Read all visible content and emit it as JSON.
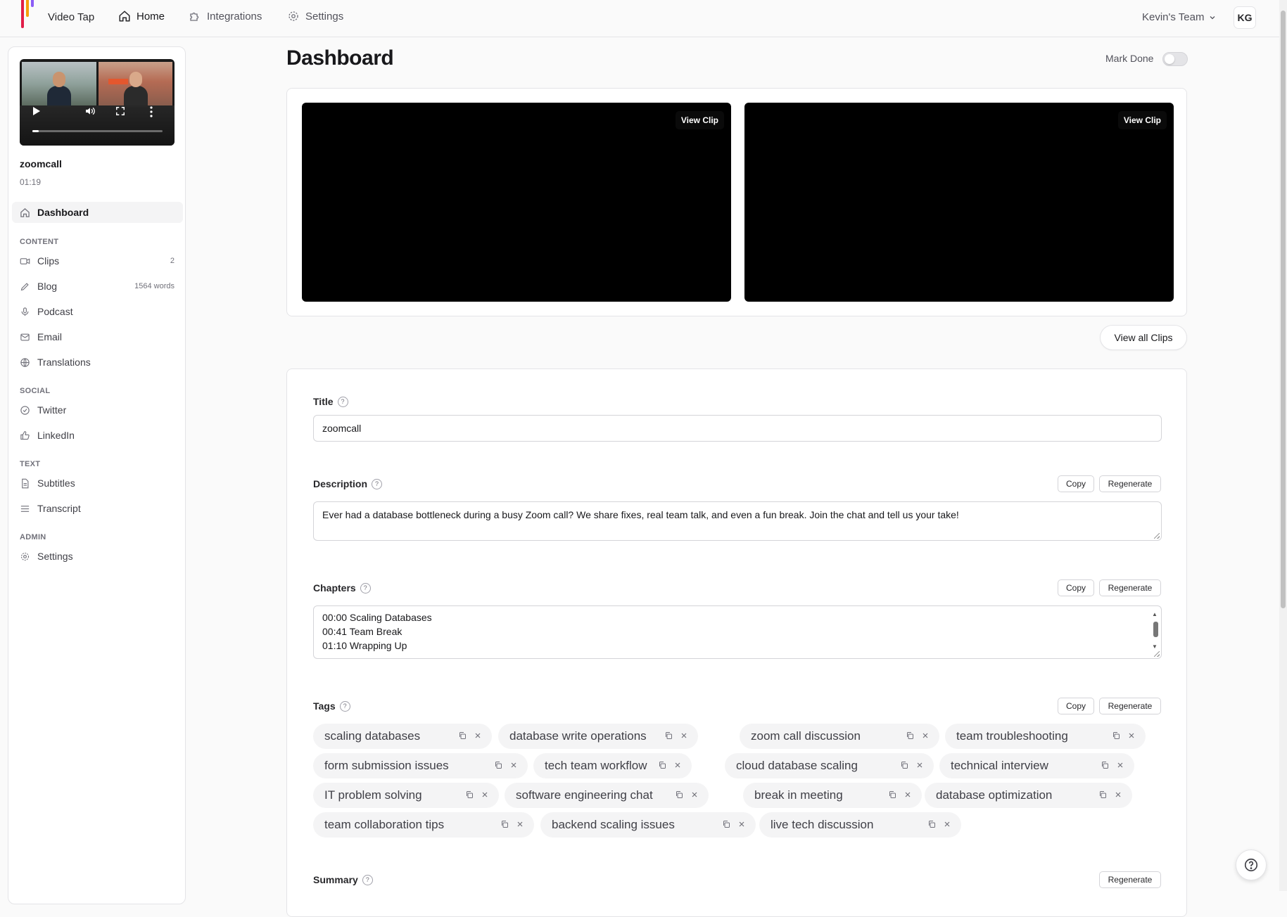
{
  "app": {
    "brand": "Video Tap",
    "nav": [
      {
        "label": "Home",
        "icon": "home-icon"
      },
      {
        "label": "Integrations",
        "icon": "puzzle-icon"
      },
      {
        "label": "Settings",
        "icon": "gear-icon"
      }
    ],
    "team": "Kevin's Team",
    "avatar_initials": "KG",
    "logo_colors": [
      "#e11d48",
      "#f59e0b",
      "#8b5cf6"
    ]
  },
  "sidebar": {
    "video": {
      "title": "zoomcall",
      "duration": "01:19",
      "progress": 0.05
    },
    "dashboard": "Dashboard",
    "sections": {
      "content": "CONTENT",
      "social": "SOCIAL",
      "text": "TEXT",
      "admin": "ADMIN"
    },
    "items": {
      "clips": {
        "label": "Clips",
        "count": "2"
      },
      "blog": {
        "label": "Blog",
        "count": "1564 words"
      },
      "podcast": {
        "label": "Podcast"
      },
      "email": {
        "label": "Email"
      },
      "translations": {
        "label": "Translations"
      },
      "twitter": {
        "label": "Twitter"
      },
      "linkedin": {
        "label": "LinkedIn"
      },
      "subtitles": {
        "label": "Subtitles"
      },
      "transcript": {
        "label": "Transcript"
      },
      "settings": {
        "label": "Settings"
      }
    }
  },
  "main": {
    "page_title": "Dashboard",
    "mark_done": {
      "label": "Mark Done",
      "checked": false
    },
    "clips": {
      "view_clip_label": "View Clip",
      "count": 2
    },
    "view_all_clips": "View all Clips",
    "title_field": {
      "label": "Title",
      "help": "?",
      "value": "zoomcall"
    },
    "description": {
      "label": "Description",
      "help": "?",
      "value": "Ever had a database bottleneck during a busy Zoom call? We share fixes, real team talk, and even a fun break. Join the chat and tell us your take!"
    },
    "chapters": {
      "label": "Chapters",
      "help": "?",
      "lines": [
        "00:00 Scaling Databases",
        "00:41 Team Break",
        "01:10 Wrapping Up"
      ]
    },
    "tags": {
      "label": "Tags",
      "help": "?",
      "items": [
        "scaling databases",
        "database write operations",
        "zoom call discussion",
        "team troubleshooting",
        "form submission issues",
        "tech team workflow",
        "cloud database scaling",
        "technical interview",
        "IT problem solving",
        "software engineering chat",
        "break in meeting",
        "database optimization",
        "team collaboration tips",
        "backend scaling issues",
        "live tech discussion"
      ]
    },
    "summary": {
      "label": "Summary",
      "help": "?"
    },
    "buttons": {
      "copy": "Copy",
      "regenerate": "Regenerate"
    }
  }
}
